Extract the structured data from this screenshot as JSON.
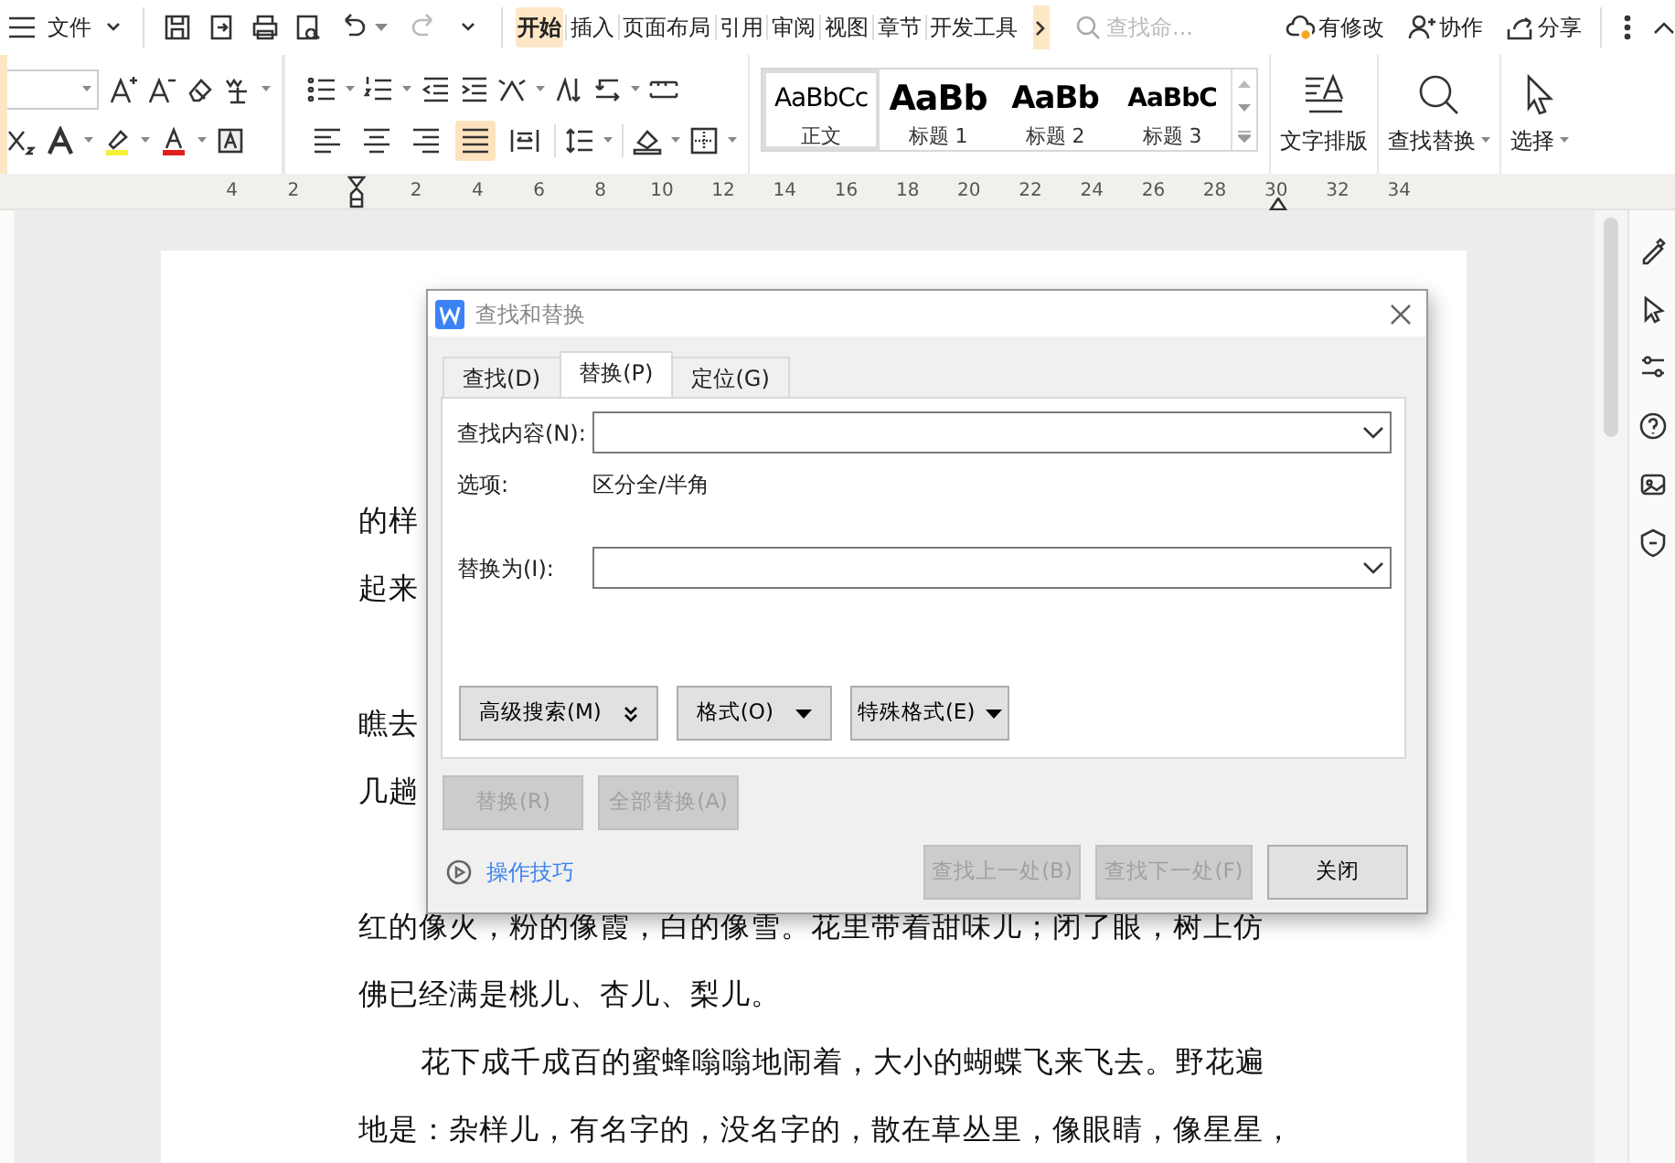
{
  "top_bar": {
    "file_menu": "文件",
    "tabs": [
      {
        "label": "开始",
        "selected": true
      },
      {
        "label": "插入",
        "selected": false
      },
      {
        "label": "页面布局",
        "selected": false
      },
      {
        "label": "引用",
        "selected": false
      },
      {
        "label": "审阅",
        "selected": false
      },
      {
        "label": "视图",
        "selected": false
      },
      {
        "label": "章节",
        "selected": false
      },
      {
        "label": "开发工具",
        "selected": false
      }
    ],
    "search": {
      "placeholder": "查找命..."
    },
    "actions": [
      {
        "kind": "cloud",
        "label": "有修改"
      },
      {
        "kind": "collab",
        "label": "协作"
      },
      {
        "kind": "share",
        "label": "分享"
      }
    ]
  },
  "ribbon": {
    "alignment_buttons": [
      {
        "kind": "left",
        "selected": false
      },
      {
        "kind": "center",
        "selected": false
      },
      {
        "kind": "right",
        "selected": false
      },
      {
        "kind": "justify",
        "selected": true
      },
      {
        "kind": "distributed",
        "selected": false
      }
    ],
    "styles": [
      {
        "kind": "body",
        "sample": "AaBbCc",
        "label": "正文",
        "selected": true
      },
      {
        "kind": "h1",
        "sample": "AaBb",
        "label": "标题 1",
        "selected": false
      },
      {
        "kind": "h2",
        "sample": "AaBb",
        "label": "标题 2",
        "selected": false
      },
      {
        "kind": "h3",
        "sample": "AaBbC",
        "label": "标题 3",
        "selected": false
      }
    ],
    "big_buttons": [
      {
        "kind": "layout",
        "label": "文字排版"
      },
      {
        "kind": "find",
        "label": "查找替换"
      },
      {
        "kind": "select",
        "label": "选择"
      }
    ]
  },
  "ruler": {
    "numbers": [
      "4",
      "2",
      "2",
      "4",
      "6",
      "8",
      "10",
      "12",
      "14",
      "16",
      "18",
      "20",
      "22",
      "24",
      "26",
      "28",
      "30",
      "32",
      "34"
    ]
  },
  "document": {
    "lines": [
      {
        "text": "的样",
        "indent": false
      },
      {
        "text": "起来",
        "indent": false
      },
      {
        "text": "瞧去",
        "indent": false
      },
      {
        "text": "几趟",
        "indent": false
      },
      {
        "text": "红的像火，粉的像霞，白的像雪。花里带着甜味儿；闭了眼，树上仿",
        "indent": false
      },
      {
        "text": "佛已经满是桃儿、杏儿、梨儿。",
        "indent": false
      },
      {
        "text": "花下成千成百的蜜蜂嗡嗡地闹着，大小的蝴蝶飞来飞去。野花遍",
        "indent": true
      },
      {
        "text": "地是：杂样儿，有名字的，没名字的，散在草丛里，像眼睛，像星星，",
        "indent": false
      }
    ]
  },
  "dialog": {
    "title": "查找和替换",
    "tabs": [
      {
        "label": "查找(D)",
        "selected": false
      },
      {
        "label": "替换(P)",
        "selected": true
      },
      {
        "label": "定位(G)",
        "selected": false
      }
    ],
    "find_label": "查找内容(N):",
    "options_label": "选项:",
    "options_value": "区分全/半角",
    "replace_label": "替换为(I):",
    "option_buttons": [
      {
        "label": "高级搜索(M)",
        "kind": "double"
      },
      {
        "label": "格式(O)",
        "kind": "caret"
      },
      {
        "label": "特殊格式(E)",
        "kind": "caret"
      }
    ],
    "replace_buttons": [
      {
        "label": "替换(R)",
        "disabled": true
      },
      {
        "label": "全部替换(A)",
        "disabled": true
      }
    ],
    "tips_link": "操作技巧",
    "bottom_buttons": [
      {
        "label": "查找上一处(B)",
        "disabled": true
      },
      {
        "label": "查找下一处(F)",
        "disabled": true
      },
      {
        "label": "关闭",
        "disabled": false
      }
    ]
  }
}
